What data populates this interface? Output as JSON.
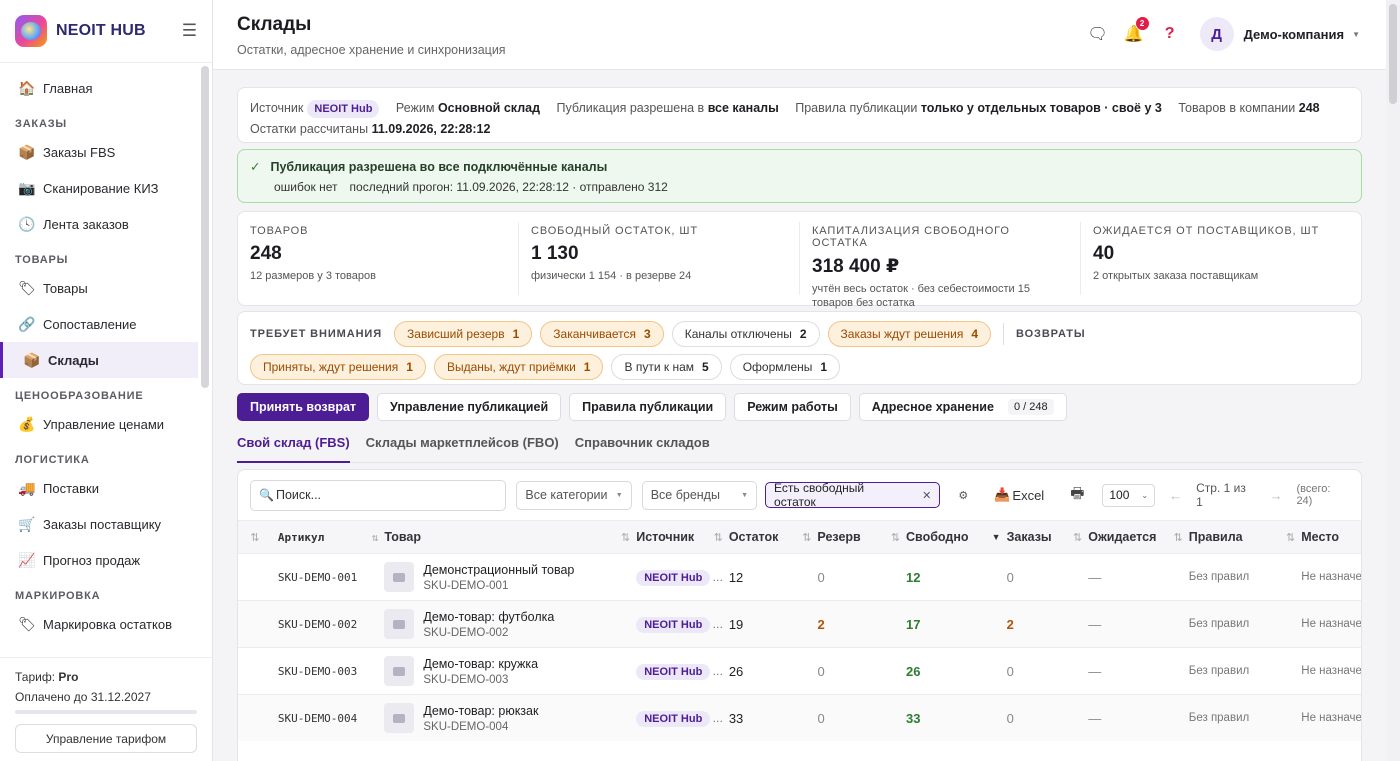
{
  "sidebar": {
    "brand": "NEOIT HUB",
    "items": [
      {
        "type": "item",
        "icon": "home-icon",
        "glyph": "🏠",
        "label": "Главная"
      },
      {
        "type": "section",
        "label": "ЗАКАЗЫ"
      },
      {
        "type": "item",
        "icon": "package-icon",
        "glyph": "📦",
        "label": "Заказы FBS"
      },
      {
        "type": "item",
        "icon": "camera-icon",
        "glyph": "📷",
        "label": "Сканирование КИЗ"
      },
      {
        "type": "item",
        "icon": "clock-icon",
        "glyph": "🕓",
        "label": "Лента заказов"
      },
      {
        "type": "section",
        "label": "ТОВАРЫ"
      },
      {
        "type": "item",
        "icon": "label-icon",
        "glyph": "🏷",
        "label": "Товары"
      },
      {
        "type": "item",
        "icon": "link-icon",
        "glyph": "🔗",
        "label": "Сопоставление"
      },
      {
        "type": "item",
        "icon": "warehouse-icon",
        "glyph": "📦",
        "label": "Склады",
        "active": true
      },
      {
        "type": "section",
        "label": "ЦЕНООБРАЗОВАНИЕ"
      },
      {
        "type": "item",
        "icon": "money-bag-icon",
        "glyph": "💰",
        "label": "Управление ценами"
      },
      {
        "type": "section",
        "label": "ЛОГИСТИКА"
      },
      {
        "type": "item",
        "icon": "truck-icon",
        "glyph": "🚚",
        "label": "Поставки"
      },
      {
        "type": "item",
        "icon": "cart-icon",
        "glyph": "🛒",
        "label": "Заказы поставщику"
      },
      {
        "type": "item",
        "icon": "chart-icon",
        "glyph": "📈",
        "label": "Прогноз продаж"
      },
      {
        "type": "section",
        "label": "МАРКИРОВКА"
      },
      {
        "type": "item",
        "icon": "label-icon",
        "glyph": "🏷",
        "label": "Маркировка остатков"
      }
    ],
    "plan_label": "Тариф:",
    "plan_value": "Pro",
    "paid_until": "Оплачено до 31.12.2027",
    "plan_button": "Управление тарифом"
  },
  "header": {
    "title": "Склады",
    "subtitle": "Остатки, адресное хранение и синхронизация",
    "notifications": "2",
    "avatar": "Д",
    "company": "Демо-компания"
  },
  "info": {
    "source_label": "Источник",
    "source_value": "NEOIT Hub",
    "mode_label": "Режим",
    "mode_value": "Основной склад",
    "publish_label": "Публикация разрешена в",
    "publish_value": "все каналы",
    "rules_label": "Правила публикации",
    "rules_value": "только у отдельных товаров · своё у 3",
    "products_label": "Товаров в компании",
    "products_value": "248",
    "calc_label": "Остатки рассчитаны",
    "calc_value": "11.09.2026, 22:28:12"
  },
  "ok": {
    "title": "Публикация разрешена во все подключённые каналы",
    "errors": "ошибок нет",
    "last_run": "последний прогон: 11.09.2026, 22:28:12 · отправлено 312"
  },
  "stats": [
    {
      "label": "ТОВАРОВ",
      "value": "248",
      "note": "12 размеров у 3 товаров"
    },
    {
      "label": "СВОБОДНЫЙ ОСТАТОК, ШТ",
      "value": "1 130",
      "note": "физически 1 154 · в резерве 24"
    },
    {
      "label": "КАПИТАЛИЗАЦИЯ СВОБОДНОГО ОСТАТКА",
      "value": "318 400 ₽",
      "note": "учтён весь остаток · без себестоимости 15 товаров без остатка"
    },
    {
      "label": "ОЖИДАЕТСЯ ОТ ПОСТАВЩИКОВ, ШТ",
      "value": "40",
      "note": "2 открытых заказа поставщикам"
    }
  ],
  "attention": {
    "label": "ТРЕБУЕТ ВНИМАНИЯ",
    "returns_label": "ВОЗВРАТЫ",
    "row1": [
      {
        "label": "Зависший резерв",
        "count": "1",
        "warn": true
      },
      {
        "label": "Заканчивается",
        "count": "3",
        "warn": true
      },
      {
        "label": "Каналы отключены",
        "count": "2",
        "warn": false
      },
      {
        "label": "Заказы ждут решения",
        "count": "4",
        "warn": true
      }
    ],
    "row2": [
      {
        "label": "Приняты, ждут решения",
        "count": "1",
        "warn": true
      },
      {
        "label": "Выданы, ждут приёмки",
        "count": "1",
        "warn": true
      },
      {
        "label": "В пути к нам",
        "count": "5",
        "warn": false
      },
      {
        "label": "Оформлены",
        "count": "1",
        "warn": false
      }
    ]
  },
  "actions": {
    "accept_return": "Принять возврат",
    "manage_publication": "Управление публикацией",
    "publication_rules": "Правила публикации",
    "work_mode": "Режим работы",
    "address_storage": "Адресное хранение",
    "address_count": "0 / 248"
  },
  "tabs": [
    "Свой склад (FBS)",
    "Склады маркетплейсов (FBO)",
    "Справочник складов"
  ],
  "filters": {
    "search_placeholder": "Поиск...",
    "categories": "Все категории",
    "brands": "Все бренды",
    "active_filter": "Есть свободный остаток",
    "excel": "Excel",
    "page_size": "100",
    "page": "Стр. 1 из 1",
    "total": "(всего: 24)"
  },
  "table": {
    "columns": [
      "Артикул",
      "Товар",
      "Источник",
      "Остаток",
      "Резерв",
      "Свободно",
      "Заказы",
      "Ожидается",
      "Правила",
      "Место"
    ],
    "rows": [
      {
        "sku": "SKU-DEMO-001",
        "name": "Демонстрационный товар",
        "sub": "SKU-DEMO-001",
        "source": "NEOIT Hub",
        "more": "…",
        "stock": "12",
        "reserve": "0",
        "free": "12",
        "orders": "0",
        "expected": "—",
        "rules": "Без правил",
        "place": "Не назначено"
      },
      {
        "sku": "SKU-DEMO-002",
        "name": "Демо-товар: футболка",
        "sub": "SKU-DEMO-002",
        "source": "NEOIT Hub",
        "more": "…",
        "stock": "19",
        "reserve": "2",
        "free": "17",
        "orders": "2",
        "expected": "—",
        "rules": "Без правил",
        "place": "Не назначено"
      },
      {
        "sku": "SKU-DEMO-003",
        "name": "Демо-товар: кружка",
        "sub": "SKU-DEMO-003",
        "source": "NEOIT Hub",
        "more": "…",
        "stock": "26",
        "reserve": "0",
        "free": "26",
        "orders": "0",
        "expected": "—",
        "rules": "Без правил",
        "place": "Не назначено"
      },
      {
        "sku": "SKU-DEMO-004",
        "name": "Демо-товар: рюкзак",
        "sub": "SKU-DEMO-004",
        "source": "NEOIT Hub",
        "more": "…",
        "stock": "33",
        "reserve": "0",
        "free": "33",
        "orders": "0",
        "expected": "—",
        "rules": "Без правил",
        "place": "Не назначено"
      }
    ]
  }
}
